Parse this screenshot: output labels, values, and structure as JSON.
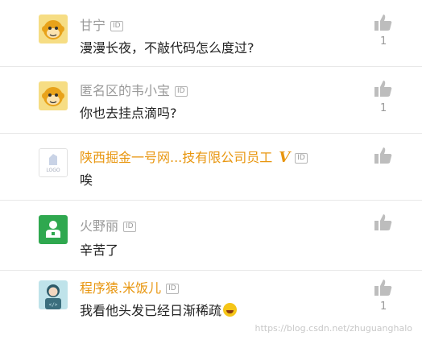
{
  "comments": [
    {
      "username": "甘宁",
      "id_badge": "ID",
      "text": "漫漫长夜，不敲代码怎么度过?",
      "likes": "1",
      "avatar": "monkey-avatar-icon"
    },
    {
      "username": "匿名区的韦小宝",
      "id_badge": "ID",
      "text": "你也去挂点滴吗?",
      "likes": "1",
      "avatar": "monkey-avatar-icon"
    },
    {
      "username": "陕西掘金一号网...技有限公司员工",
      "verified_mark": "V",
      "id_badge": "ID",
      "text": "唉",
      "likes": "",
      "avatar": "company-logo-icon",
      "logo_text": "LOGO"
    },
    {
      "username": "火野丽",
      "id_badge": "ID",
      "text": "辛苦了",
      "likes": "",
      "avatar": "user-avatar-icon"
    },
    {
      "username": "程序猿.米饭儿",
      "id_badge": "ID",
      "text": "我看他头发已经日渐稀疏",
      "likes": "1",
      "avatar": "coder-avatar-icon"
    }
  ],
  "icons": {
    "like": "thumbs-up-icon",
    "emoji": "grin-emoji-icon"
  },
  "watermark": "https://blog.csdn.net/zhuguanghalo",
  "colors": {
    "username_gray": "#9a9a9a",
    "username_orange": "#e8960f",
    "divider": "#e8e8e8",
    "avatar_yellow": "#f3d36a",
    "avatar_green": "#2fa84f"
  }
}
